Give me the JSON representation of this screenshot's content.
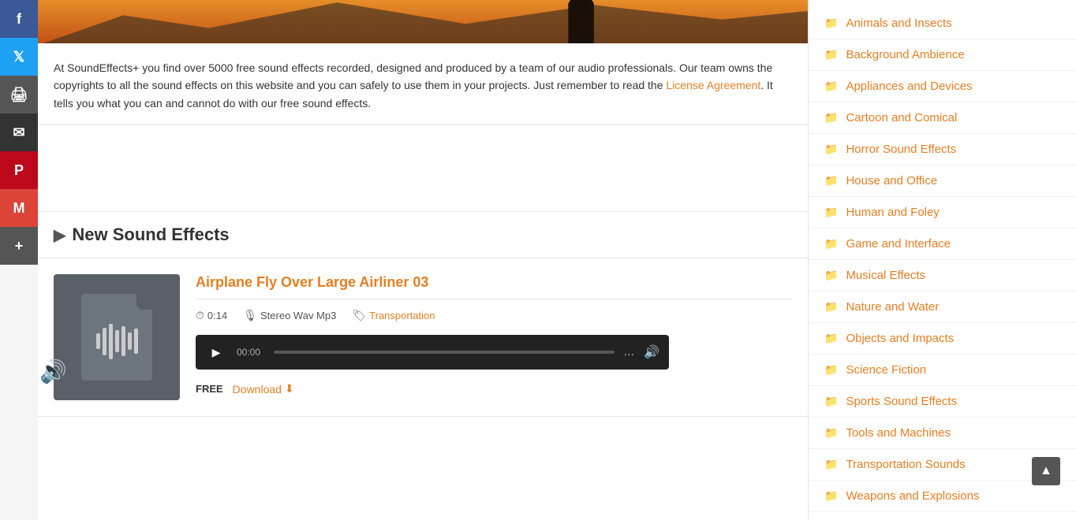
{
  "social": {
    "buttons": [
      {
        "label": "f",
        "name": "facebook",
        "class": "facebook",
        "title": "Share on Facebook"
      },
      {
        "label": "t",
        "name": "twitter",
        "class": "twitter",
        "title": "Share on Twitter"
      },
      {
        "label": "🖨",
        "name": "print",
        "class": "print",
        "title": "Print"
      },
      {
        "label": "✉",
        "name": "email",
        "class": "email",
        "title": "Email"
      },
      {
        "label": "P",
        "name": "pinterest",
        "class": "pinterest",
        "title": "Share on Pinterest"
      },
      {
        "label": "M",
        "name": "gmail",
        "class": "gmail",
        "title": "Gmail"
      },
      {
        "label": "+",
        "name": "more",
        "class": "more",
        "title": "More"
      }
    ]
  },
  "description": {
    "text1": "At SoundEffects+ you find over 5000 free sound effects recorded, designed and produced by a team of our audio professionals. Our team owns the copyrights to all the sound effects on this website and you can safely to use them in your projects. Just remember to read the ",
    "link_text": "License Agreement",
    "text2": ". It tells you what you can and cannot do with our free sound effects."
  },
  "section": {
    "heading": "New Sound Effects"
  },
  "sound_effect": {
    "title": "Airplane Fly Over Large Airliner 03",
    "duration": "0:14",
    "format": "Stereo Wav Mp3",
    "tag": "Transportation",
    "player": {
      "time": "00:00",
      "dots": "..."
    },
    "price": "FREE",
    "download_label": "Download"
  },
  "sidebar": {
    "categories": [
      {
        "label": "Animals and Insects"
      },
      {
        "label": "Background Ambience"
      },
      {
        "label": "Appliances and Devices"
      },
      {
        "label": "Cartoon and Comical"
      },
      {
        "label": "Horror Sound Effects"
      },
      {
        "label": "House and Office"
      },
      {
        "label": "Human and Foley"
      },
      {
        "label": "Game and Interface"
      },
      {
        "label": "Musical Effects"
      },
      {
        "label": "Nature and Water"
      },
      {
        "label": "Objects and Impacts"
      },
      {
        "label": "Science Fiction"
      },
      {
        "label": "Sports Sound Effects"
      },
      {
        "label": "Tools and Machines"
      },
      {
        "label": "Transportation Sounds"
      },
      {
        "label": "Weapons and Explosions"
      }
    ]
  },
  "scroll_top": "▲"
}
